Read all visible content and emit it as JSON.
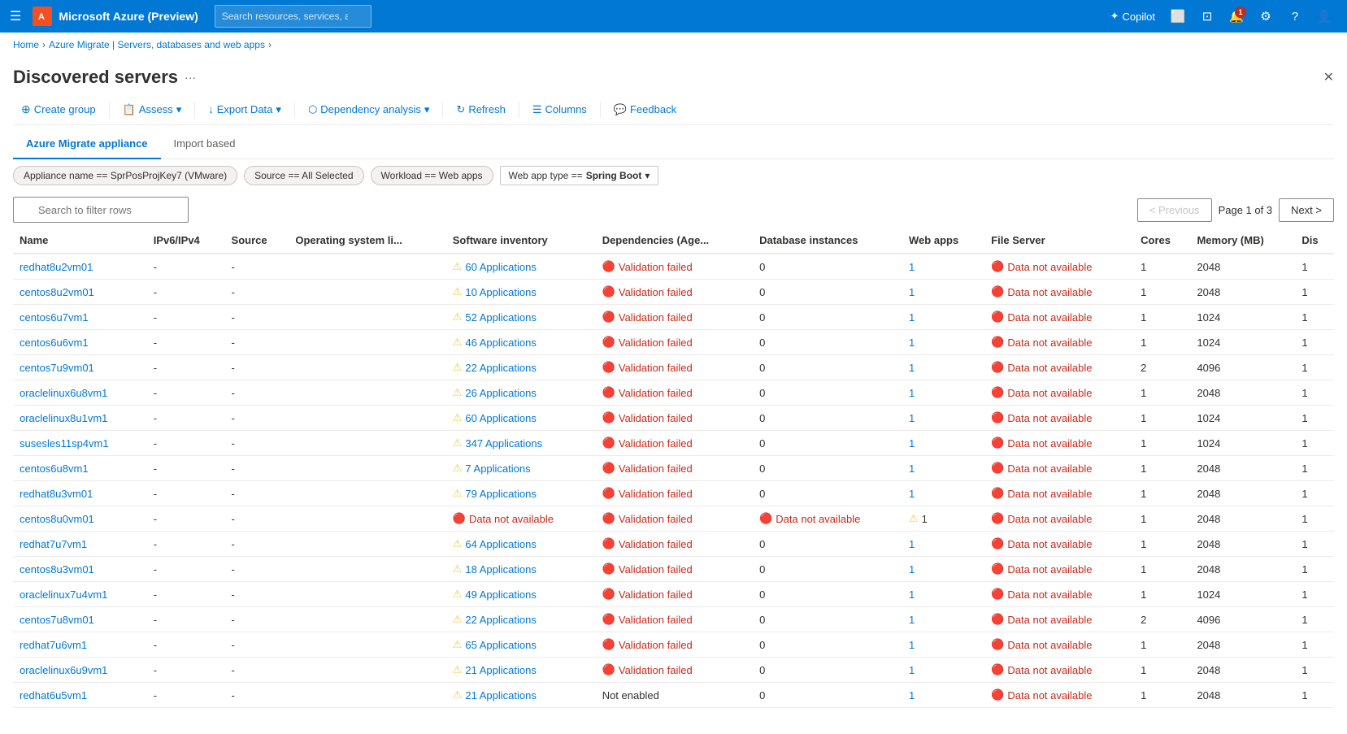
{
  "topbar": {
    "hamburger": "☰",
    "title": "Microsoft Azure (Preview)",
    "search_placeholder": "Search resources, services, and docs (G+/)",
    "copilot_label": "Copilot",
    "azure_icon": "🔶"
  },
  "breadcrumbs": [
    {
      "label": "Home",
      "link": true
    },
    {
      "label": "Azure Migrate | Servers, databases and web apps",
      "link": true
    },
    {
      "label": "",
      "link": false
    }
  ],
  "page": {
    "title": "Discovered servers",
    "options_icon": "···",
    "close_icon": "✕"
  },
  "toolbar": {
    "create_group": "Create group",
    "assess": "Assess",
    "export_data": "Export Data",
    "dependency_analysis": "Dependency analysis",
    "refresh": "Refresh",
    "columns": "Columns",
    "feedback": "Feedback"
  },
  "tabs": [
    {
      "label": "Azure Migrate appliance",
      "active": true
    },
    {
      "label": "Import based",
      "active": false
    }
  ],
  "filters": [
    {
      "label": "Appliance name == SprPosProjKey7 (VMware)"
    },
    {
      "label": "Source == All Selected"
    },
    {
      "label": "Workload == Web apps"
    },
    {
      "label": "Web app type ==",
      "dropdown": "Spring Boot"
    }
  ],
  "search": {
    "placeholder": "Search to filter rows"
  },
  "pagination": {
    "previous_label": "< Previous",
    "next_label": "Next >",
    "page_info": "Page 1 of 3"
  },
  "columns": [
    {
      "label": "Name"
    },
    {
      "label": "IPv6/IPv4"
    },
    {
      "label": "Source"
    },
    {
      "label": "Operating system li..."
    },
    {
      "label": "Software inventory"
    },
    {
      "label": "Dependencies (Age..."
    },
    {
      "label": "Database instances"
    },
    {
      "label": "Web apps"
    },
    {
      "label": "File Server"
    },
    {
      "label": "Cores"
    },
    {
      "label": "Memory (MB)"
    },
    {
      "label": "Dis"
    }
  ],
  "rows": [
    {
      "name": "redhat8u2vm01",
      "ipv": "-",
      "source": "-",
      "os_li": "",
      "sw_icon": "warning",
      "sw_count": "60",
      "sw_label": "Applications",
      "dep_icon": "error",
      "dep_label": "Validation failed",
      "db": "0",
      "webapps": "1",
      "webapps_link": true,
      "fs_icon": "error",
      "fs_label": "Data not available",
      "cores": "1",
      "memory": "2048",
      "dis": "1"
    },
    {
      "name": "centos8u2vm01",
      "ipv": "-",
      "source": "-",
      "os_li": "",
      "sw_icon": "warning",
      "sw_count": "10",
      "sw_label": "Applications",
      "dep_icon": "error",
      "dep_label": "Validation failed",
      "db": "0",
      "webapps": "1",
      "webapps_link": true,
      "fs_icon": "error",
      "fs_label": "Data not available",
      "cores": "1",
      "memory": "2048",
      "dis": "1"
    },
    {
      "name": "centos6u7vm1",
      "ipv": "-",
      "source": "-",
      "os_li": "",
      "sw_icon": "warning",
      "sw_count": "52",
      "sw_label": "Applications",
      "dep_icon": "error",
      "dep_label": "Validation failed",
      "db": "0",
      "webapps": "1",
      "webapps_link": true,
      "fs_icon": "error",
      "fs_label": "Data not available",
      "cores": "1",
      "memory": "1024",
      "dis": "1"
    },
    {
      "name": "centos6u6vm1",
      "ipv": "-",
      "source": "-",
      "os_li": "",
      "sw_icon": "warning",
      "sw_count": "46",
      "sw_label": "Applications",
      "dep_icon": "error",
      "dep_label": "Validation failed",
      "db": "0",
      "webapps": "1",
      "webapps_link": true,
      "fs_icon": "error",
      "fs_label": "Data not available",
      "cores": "1",
      "memory": "1024",
      "dis": "1"
    },
    {
      "name": "centos7u9vm01",
      "ipv": "-",
      "source": "-",
      "os_li": "",
      "sw_icon": "warning",
      "sw_count": "22",
      "sw_label": "Applications",
      "dep_icon": "error",
      "dep_label": "Validation failed",
      "db": "0",
      "webapps": "1",
      "webapps_link": true,
      "fs_icon": "error",
      "fs_label": "Data not available",
      "cores": "2",
      "memory": "4096",
      "dis": "1"
    },
    {
      "name": "oraclelinux6u8vm1",
      "ipv": "-",
      "source": "-",
      "os_li": "",
      "sw_icon": "warning",
      "sw_count": "26",
      "sw_label": "Applications",
      "dep_icon": "error",
      "dep_label": "Validation failed",
      "db": "0",
      "webapps": "1",
      "webapps_link": true,
      "fs_icon": "error",
      "fs_label": "Data not available",
      "cores": "1",
      "memory": "2048",
      "dis": "1"
    },
    {
      "name": "oraclelinux8u1vm1",
      "ipv": "-",
      "source": "-",
      "os_li": "",
      "sw_icon": "warning",
      "sw_count": "60",
      "sw_label": "Applications",
      "dep_icon": "error",
      "dep_label": "Validation failed",
      "db": "0",
      "webapps": "1",
      "webapps_link": true,
      "fs_icon": "error",
      "fs_label": "Data not available",
      "cores": "1",
      "memory": "1024",
      "dis": "1"
    },
    {
      "name": "susesles11sp4vm1",
      "ipv": "-",
      "source": "-",
      "os_li": "",
      "sw_icon": "warning",
      "sw_count": "347",
      "sw_label": "Applications",
      "dep_icon": "error",
      "dep_label": "Validation failed",
      "db": "0",
      "webapps": "1",
      "webapps_link": true,
      "fs_icon": "error",
      "fs_label": "Data not available",
      "cores": "1",
      "memory": "1024",
      "dis": "1"
    },
    {
      "name": "centos6u8vm1",
      "ipv": "-",
      "source": "-",
      "os_li": "",
      "sw_icon": "warning",
      "sw_count": "7",
      "sw_label": "Applications",
      "dep_icon": "error",
      "dep_label": "Validation failed",
      "db": "0",
      "webapps": "1",
      "webapps_link": true,
      "fs_icon": "error",
      "fs_label": "Data not available",
      "cores": "1",
      "memory": "2048",
      "dis": "1"
    },
    {
      "name": "redhat8u3vm01",
      "ipv": "-",
      "source": "-",
      "os_li": "",
      "sw_icon": "warning",
      "sw_count": "79",
      "sw_label": "Applications",
      "dep_icon": "error",
      "dep_label": "Validation failed",
      "db": "0",
      "webapps": "1",
      "webapps_link": true,
      "fs_icon": "error",
      "fs_label": "Data not available",
      "cores": "1",
      "memory": "2048",
      "dis": "1"
    },
    {
      "name": "centos8u0vm01",
      "ipv": "-",
      "source": "-",
      "os_li": "",
      "sw_icon": "error",
      "sw_count": "",
      "sw_label": "Data not available",
      "dep_icon": "error",
      "dep_label": "Validation failed",
      "db": "0",
      "webapps": "1",
      "webapps_link": false,
      "webapps_warn": true,
      "db_error": true,
      "fs_icon": "error",
      "fs_label": "Data not available",
      "cores": "1",
      "memory": "2048",
      "dis": "1"
    },
    {
      "name": "redhat7u7vm1",
      "ipv": "-",
      "source": "-",
      "os_li": "",
      "sw_icon": "warning",
      "sw_count": "64",
      "sw_label": "Applications",
      "dep_icon": "error",
      "dep_label": "Validation failed",
      "db": "0",
      "webapps": "1",
      "webapps_link": true,
      "fs_icon": "error",
      "fs_label": "Data not available",
      "cores": "1",
      "memory": "2048",
      "dis": "1"
    },
    {
      "name": "centos8u3vm01",
      "ipv": "-",
      "source": "-",
      "os_li": "",
      "sw_icon": "warning",
      "sw_count": "18",
      "sw_label": "Applications",
      "dep_icon": "error",
      "dep_label": "Validation failed",
      "db": "0",
      "webapps": "1",
      "webapps_link": true,
      "fs_icon": "error",
      "fs_label": "Data not available",
      "cores": "1",
      "memory": "2048",
      "dis": "1"
    },
    {
      "name": "oraclelinux7u4vm1",
      "ipv": "-",
      "source": "-",
      "os_li": "",
      "sw_icon": "warning",
      "sw_count": "49",
      "sw_label": "Applications",
      "dep_icon": "error",
      "dep_label": "Validation failed",
      "db": "0",
      "webapps": "1",
      "webapps_link": true,
      "fs_icon": "error",
      "fs_label": "Data not available",
      "cores": "1",
      "memory": "1024",
      "dis": "1"
    },
    {
      "name": "centos7u8vm01",
      "ipv": "-",
      "source": "-",
      "os_li": "",
      "sw_icon": "warning",
      "sw_count": "22",
      "sw_label": "Applications",
      "dep_icon": "error",
      "dep_label": "Validation failed",
      "db": "0",
      "webapps": "1",
      "webapps_link": true,
      "fs_icon": "error",
      "fs_label": "Data not available",
      "cores": "2",
      "memory": "4096",
      "dis": "1"
    },
    {
      "name": "redhat7u6vm1",
      "ipv": "-",
      "source": "-",
      "os_li": "",
      "sw_icon": "warning",
      "sw_count": "65",
      "sw_label": "Applications",
      "dep_icon": "error",
      "dep_label": "Validation failed",
      "db": "0",
      "webapps": "1",
      "webapps_link": true,
      "fs_icon": "error",
      "fs_label": "Data not available",
      "cores": "1",
      "memory": "2048",
      "dis": "1"
    },
    {
      "name": "oraclelinux6u9vm1",
      "ipv": "-",
      "source": "-",
      "os_li": "",
      "sw_icon": "warning",
      "sw_count": "21",
      "sw_label": "Applications",
      "dep_icon": "error",
      "dep_label": "Validation failed",
      "db": "0",
      "webapps": "1",
      "webapps_link": true,
      "fs_icon": "error",
      "fs_label": "Data not available",
      "cores": "1",
      "memory": "2048",
      "dis": "1"
    },
    {
      "name": "redhat6u5vm1",
      "ipv": "-",
      "source": "-",
      "os_li": "",
      "sw_icon": "warning",
      "sw_count": "21",
      "sw_label": "Applications",
      "dep_icon": "none",
      "dep_label": "Not enabled",
      "db": "0",
      "webapps": "1",
      "webapps_link": true,
      "fs_icon": "error",
      "fs_label": "Data not available",
      "cores": "1",
      "memory": "2048",
      "dis": "1"
    }
  ]
}
